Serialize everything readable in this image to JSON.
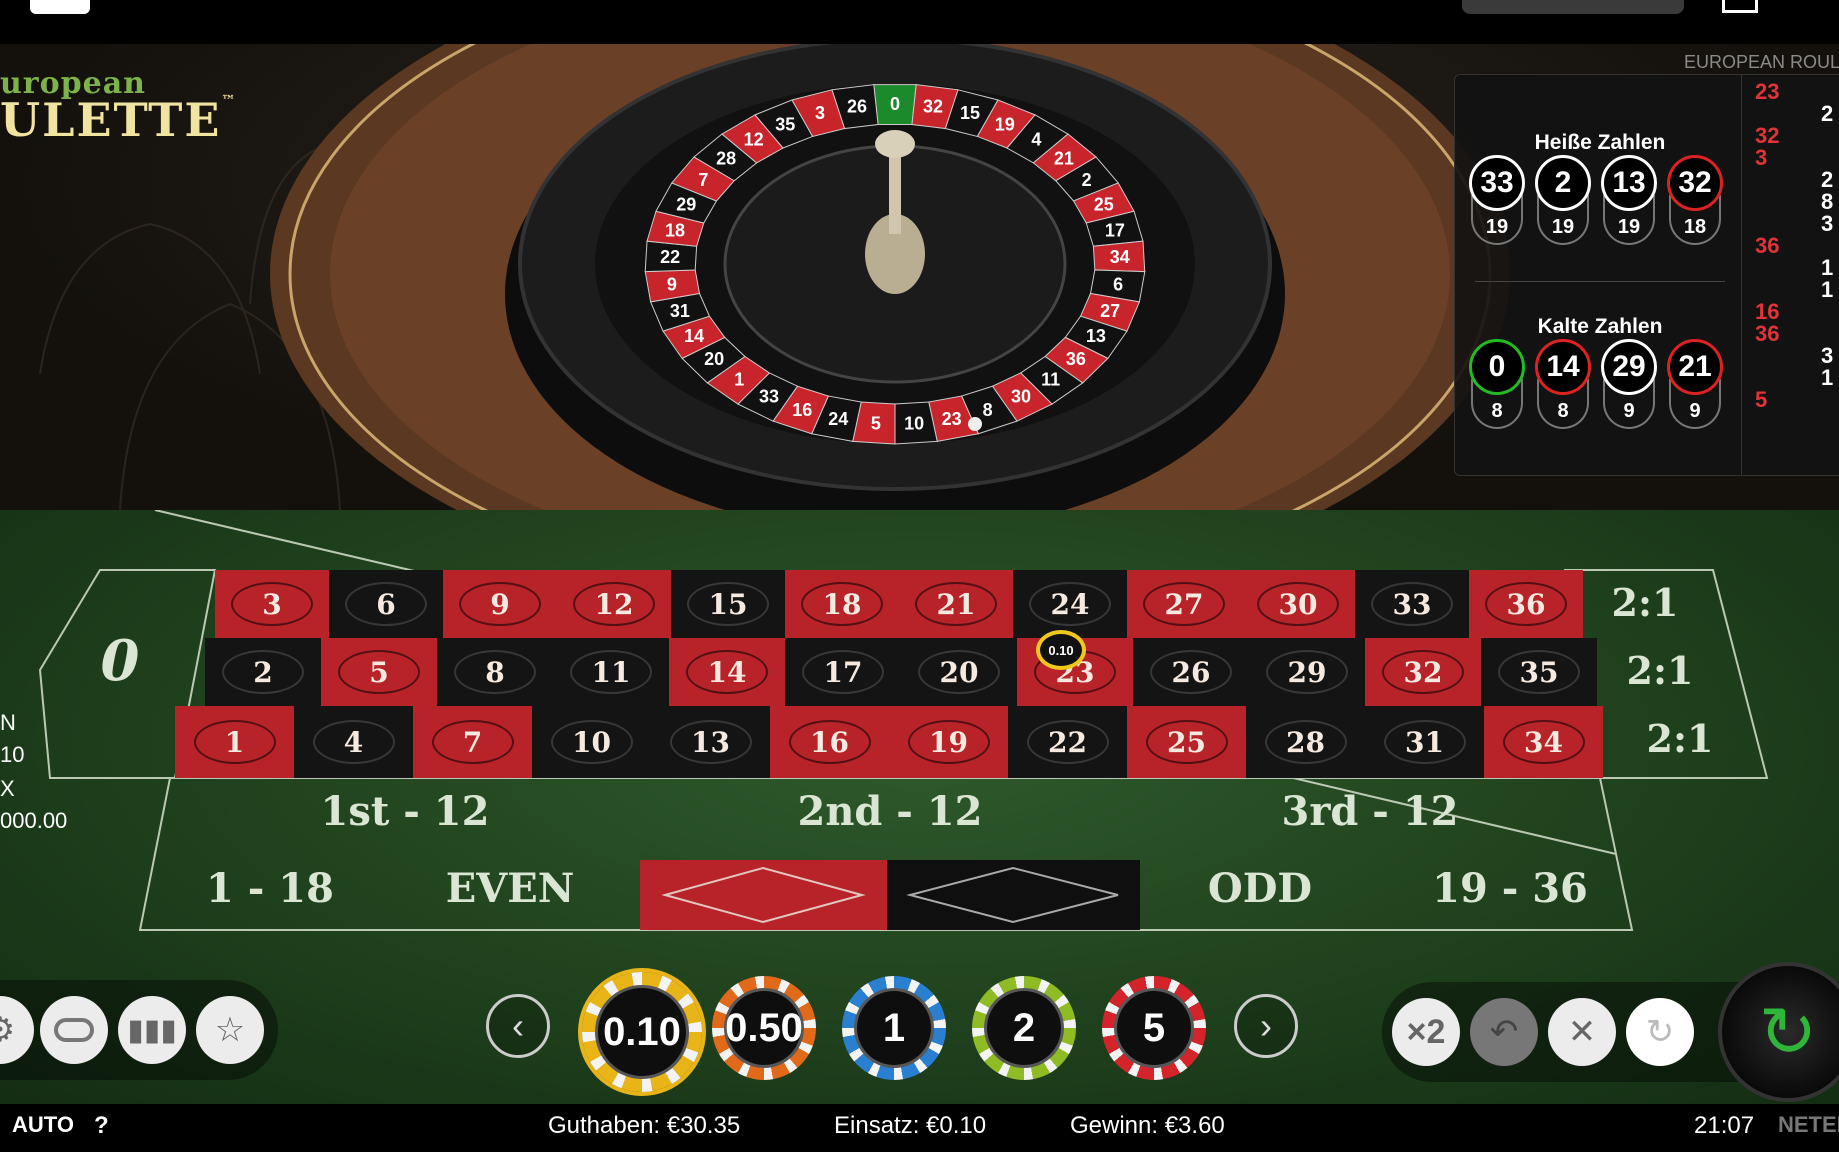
{
  "game": {
    "logo_line1": "uropean",
    "logo_line2": "ULETTE",
    "logo_tm": "™"
  },
  "wheel": {
    "numbers": [
      "0",
      "32",
      "15",
      "19",
      "4",
      "21",
      "2",
      "25",
      "17",
      "34",
      "6",
      "27",
      "13",
      "36",
      "11",
      "30",
      "8",
      "23",
      "10",
      "5",
      "24",
      "16",
      "33",
      "1",
      "20",
      "14",
      "31",
      "9",
      "22",
      "18",
      "29",
      "7",
      "28",
      "12",
      "35",
      "3",
      "26"
    ]
  },
  "stats": {
    "title": "EUROPEAN ROUL",
    "hot_title": "Heiße Zahlen",
    "hot": [
      {
        "number": "33",
        "count": "19",
        "color": "black"
      },
      {
        "number": "2",
        "count": "19",
        "color": "black"
      },
      {
        "number": "13",
        "count": "19",
        "color": "black"
      },
      {
        "number": "32",
        "count": "18",
        "color": "red"
      }
    ],
    "cold_title": "Kalte Zahlen",
    "cold": [
      {
        "number": "0",
        "count": "8",
        "color": "green"
      },
      {
        "number": "14",
        "count": "8",
        "color": "red"
      },
      {
        "number": "29",
        "count": "9",
        "color": "black"
      },
      {
        "number": "21",
        "count": "9",
        "color": "red"
      }
    ],
    "history_col1": [
      {
        "n": "23",
        "color": "red"
      },
      {
        "n": "32",
        "color": "red"
      },
      {
        "n": "3",
        "color": "red"
      },
      {
        "n": "36",
        "color": "red"
      },
      {
        "n": "16",
        "color": "red"
      },
      {
        "n": "36",
        "color": "red"
      },
      {
        "n": "5",
        "color": "red"
      }
    ],
    "history_col2": [
      "2",
      "2",
      "8",
      "3",
      "1",
      "1",
      "3",
      "1"
    ]
  },
  "table": {
    "zero": "0",
    "rows": [
      [
        "3",
        "6",
        "9",
        "12",
        "15",
        "18",
        "21",
        "24",
        "27",
        "30",
        "33",
        "36"
      ],
      [
        "2",
        "5",
        "8",
        "11",
        "14",
        "17",
        "20",
        "23",
        "26",
        "29",
        "32",
        "35"
      ],
      [
        "1",
        "4",
        "7",
        "10",
        "13",
        "16",
        "19",
        "22",
        "25",
        "28",
        "31",
        "34"
      ]
    ],
    "reds": [
      "1",
      "3",
      "5",
      "7",
      "9",
      "12",
      "14",
      "16",
      "18",
      "19",
      "21",
      "23",
      "25",
      "27",
      "30",
      "32",
      "34",
      "36"
    ],
    "columns": [
      "2:1",
      "2:1",
      "2:1"
    ],
    "dozens": [
      "1st - 12",
      "2nd - 12",
      "3rd - 12"
    ],
    "outside": {
      "low": "1 - 18",
      "even": "EVEN",
      "odd": "ODD",
      "high": "19 - 36"
    },
    "placed_chip": {
      "value": "0.10",
      "on": "23"
    }
  },
  "left_info": [
    "N",
    "10",
    "X",
    "000.00"
  ],
  "chips": [
    {
      "label": "0.10",
      "ring": "#e8b417",
      "selected": true
    },
    {
      "label": "0.50",
      "ring": "#e06a1a",
      "selected": false
    },
    {
      "label": "1",
      "ring": "#2b7fd0",
      "selected": false
    },
    {
      "label": "2",
      "ring": "#8fbb24",
      "selected": false
    },
    {
      "label": "5",
      "ring": "#d4232a",
      "selected": false
    }
  ],
  "controls": {
    "double_label": "×2"
  },
  "bottom": {
    "auto": "AUTO",
    "help": "?",
    "balance": "Guthaben: €30.35",
    "bet": "Einsatz: €0.10",
    "win": "Gewinn: €3.60",
    "time": "21:07",
    "brand": "NETEN"
  }
}
